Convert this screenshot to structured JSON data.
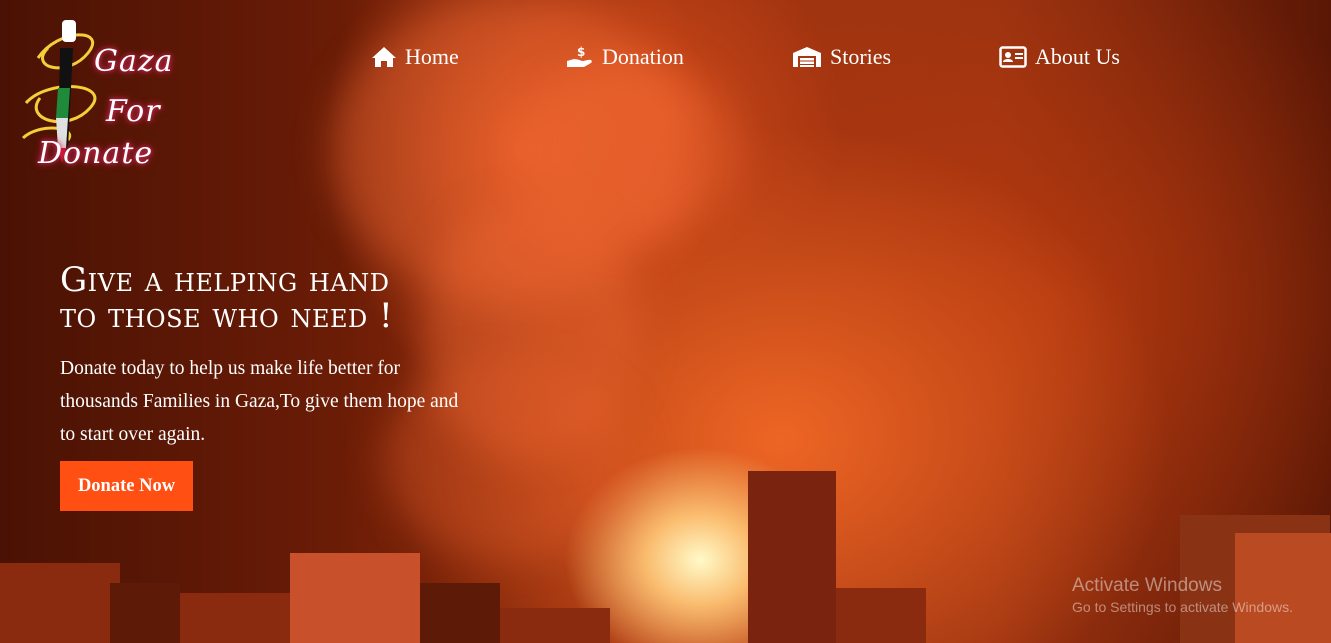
{
  "brand": {
    "logo_line1": "Gaza",
    "logo_line2": "For",
    "logo_line3": "Donate"
  },
  "nav": {
    "items": [
      {
        "label": "Home",
        "icon": "home-icon"
      },
      {
        "label": "Donation",
        "icon": "donation-hand-icon"
      },
      {
        "label": "Stories",
        "icon": "warehouse-icon"
      },
      {
        "label": "About Us",
        "icon": "id-card-icon"
      }
    ]
  },
  "hero": {
    "title_line1": "Give a helping hand",
    "title_line2": "to those who need !",
    "description": "Donate today to help us make life better for thousands Families in Gaza,To give them hope and to start over again.",
    "cta_label": "Donate Now"
  },
  "colors": {
    "accent": "#ff4f12",
    "background_dark": "#3a0d02",
    "logo_glow": "#d7275f"
  },
  "watermark": {
    "title": "Activate Windows",
    "subtitle": "Go to Settings to activate Windows."
  }
}
